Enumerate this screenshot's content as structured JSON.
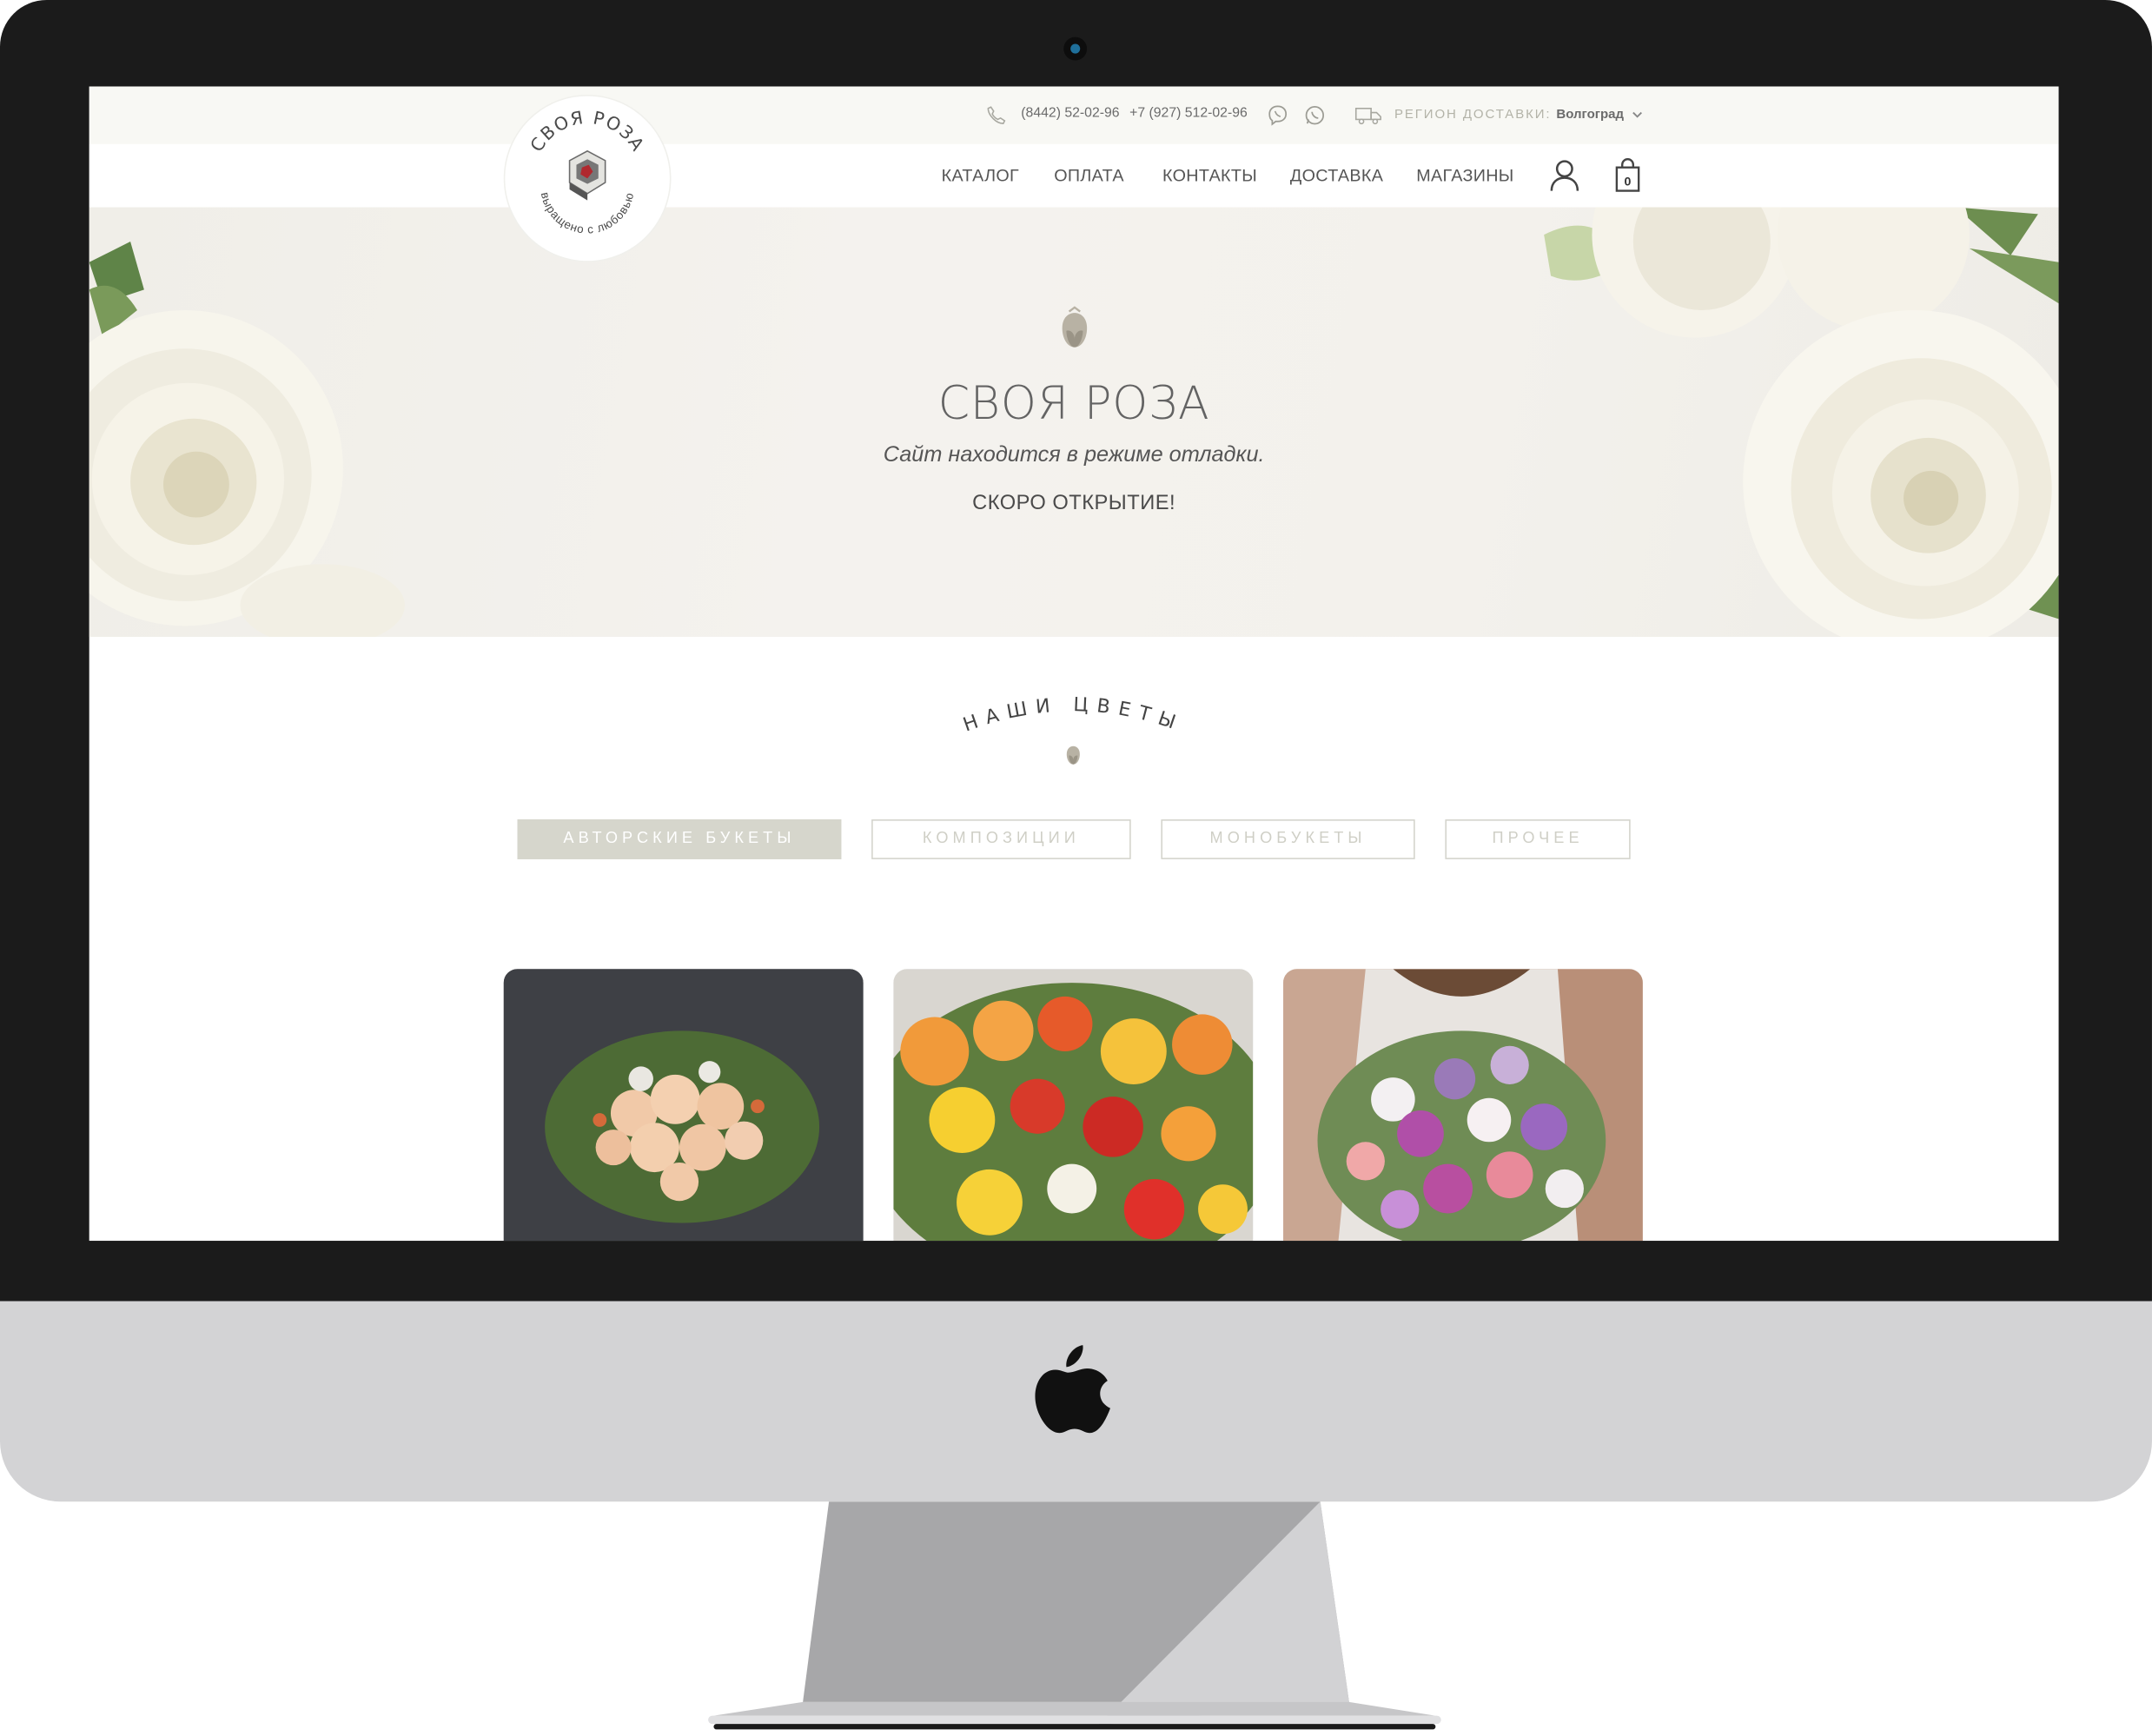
{
  "header": {
    "phone1": "(8442) 52-02-96",
    "phone2": "+7 (927) 512-02-96",
    "region_label": "РЕГИОН ДОСТАВКИ:",
    "region_city": "Волгоград",
    "cart_count": "0"
  },
  "logo": {
    "name": "СВОЯ РОЗА",
    "tagline": "выращено с любовью"
  },
  "nav": {
    "items": [
      {
        "label": "КАТАЛОГ"
      },
      {
        "label": "ОПЛАТА"
      },
      {
        "label": "КОНТАКТЫ"
      },
      {
        "label": "ДОСТАВКА"
      },
      {
        "label": "МАГАЗИНЫ"
      }
    ]
  },
  "hero": {
    "title": "СВОЯ РОЗА",
    "subtitle": "Сайт находится в режиме отладки.",
    "soon": "СКОРО ОТКРЫТИЕ!"
  },
  "section": {
    "title": "НАШИ ЦВЕТЫ"
  },
  "tabs": [
    {
      "label": "АВТОРСКИЕ БУКЕТЫ",
      "active": true
    },
    {
      "label": "КОМПОЗИЦИИ",
      "active": false
    },
    {
      "label": "МОНОБУКЕТЫ",
      "active": false
    },
    {
      "label": "ПРОЧЕЕ",
      "active": false
    }
  ],
  "icons": {
    "phone": "phone-icon",
    "viber": "viber-icon",
    "whatsapp": "whatsapp-icon",
    "truck": "truck-icon",
    "user": "user-icon",
    "cart": "shopping-bag-icon",
    "tulip": "tulip-icon"
  },
  "colors": {
    "accent": "#d6d6cc",
    "text": "#555555",
    "muted": "#b3b3a8"
  }
}
